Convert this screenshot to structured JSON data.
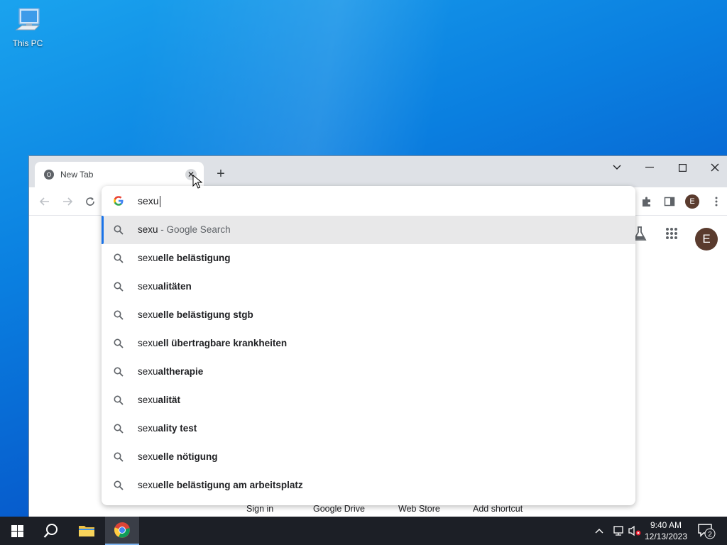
{
  "desktop": {
    "icons": [
      {
        "label": "This PC",
        "icon": "computer-icon"
      }
    ]
  },
  "browser": {
    "tab": {
      "title": "New Tab",
      "icon": "chrome-icon"
    },
    "new_tab_symbol": "+",
    "window_controls": {
      "tab_search": "⌄",
      "minimize": "—",
      "maximize": "☐",
      "close": "✕"
    },
    "profile_initial": "E",
    "omnibox": {
      "value": "sexu",
      "suggestions": [
        {
          "typed": "sexu",
          "completion": "",
          "suffix": " - Google Search",
          "selected": true
        },
        {
          "typed": "sexu",
          "completion": "elle belästigung"
        },
        {
          "typed": "sexu",
          "completion": "alitäten"
        },
        {
          "typed": "sexu",
          "completion": "elle belästigung stgb"
        },
        {
          "typed": "sexu",
          "completion": "ell übertragbare krankheiten"
        },
        {
          "typed": "sexu",
          "completion": "altherapie"
        },
        {
          "typed": "sexu",
          "completion": "alität"
        },
        {
          "typed": "sexu",
          "completion": "ality test"
        },
        {
          "typed": "sexu",
          "completion": "elle nötigung"
        },
        {
          "typed": "sexu",
          "completion": "elle belästigung am arbeitsplatz"
        }
      ]
    },
    "ntp": {
      "profile_initial": "E",
      "shortcuts": [
        "Sign in",
        "Google Drive",
        "Web Store",
        "Add shortcut"
      ]
    }
  },
  "taskbar": {
    "clock": {
      "time": "9:40 AM",
      "date": "12/13/2023"
    },
    "notification_count": "2"
  },
  "colors": {
    "accent": "#1a73e8",
    "avatar": "#5a3b2e",
    "taskbar": "#1c1f26"
  }
}
